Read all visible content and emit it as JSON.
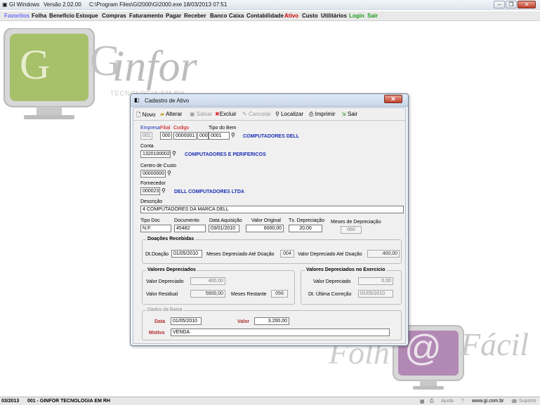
{
  "titlebar": {
    "app": "GI Windows",
    "version": "Versão  2.02.00",
    "path": "C:\\Program Files\\GI2000\\GI2000.exe",
    "datetime": "18/03/2013 07:51"
  },
  "menu": [
    "Favoritos",
    "Folha",
    "Benefício",
    "Estoque",
    "Compras",
    "Faturamento",
    "Pagar",
    "Receber",
    "Banco",
    "Caixa",
    "Contabilidade",
    "Ativo",
    "Custo",
    "Utilitários",
    "Login",
    "Sair"
  ],
  "logo": {
    "brand": "infor",
    "tagline": "TECNOLOGIA EM RH",
    "g": "G",
    "g2": "G",
    "promo1": "Folh",
    "promo2": "@",
    "promo3": "Fácil"
  },
  "window": {
    "title": "Cadastro de Ativo",
    "close": "✕",
    "toolbar": {
      "novo": "Novo",
      "alterar": "Alterar",
      "salvar": "Salvar",
      "excluir": "Excluir",
      "cancelar": "Cancelar",
      "localizar": "Localizar",
      "imprimir": "Imprimir",
      "sair": "Sair"
    },
    "labels": {
      "empresa": "Empresa",
      "filial": "Filial",
      "codigo": "Codigo",
      "tipo_bem": "Tipo do Bem",
      "conta": "Conta",
      "centro_custo": "Centro de Custo",
      "fornecedor": "Fornecedor",
      "descricao": "Descrição",
      "tipo_doc": "Tipo Doc",
      "documento": "Documento",
      "data_aquisicao": "Data Aquisição",
      "valor_original": "Valor Original",
      "tx_depreciacao": "Tx. Depreciação",
      "meses_depreciacao": "Meses de Depreciação"
    },
    "values": {
      "empresa": "001",
      "filial": "000",
      "codigo": "0000001",
      "codigo_suffix": "000",
      "tipo_bem": "0001",
      "tipo_bem_desc": "COMPUTADORES DELL",
      "conta": "1320100002",
      "conta_desc": "COMPUTADORES E PERIFERICOS",
      "centro_custo": "00000000",
      "fornecedor": "000023",
      "fornecedor_desc": "DELL COMPUTADORES LTDA",
      "descricao": "4 COMPUTADORES DA MARCA DELL",
      "tipo_doc": "N.F.",
      "documento": "45482",
      "data_aquisicao": "03/01/2010",
      "valor_original": "6000,00",
      "tx_depreciacao": "20,00",
      "meses_depreciacao": "060"
    },
    "doacoes": {
      "title": "Doações Recebidas",
      "dt_label": "Dt.Doação",
      "dt": "01/05/2010",
      "meses_label": "Meses Depreciado Até Doação",
      "meses": "004",
      "valor_label": "Valor Depreciado Até Doação",
      "valor": "400,00"
    },
    "depreciados": {
      "title": "Valores Depreciados",
      "valor_label": "Valor Depreciado",
      "valor": "400,00",
      "residual_label": "Valor Residual",
      "residual": "5600,00",
      "meses_label": "Meses Restante",
      "meses": "056"
    },
    "exercicio": {
      "title": "Valores Depreciados no Exercicio",
      "valor_label": "Valor Depreciado",
      "valor": "0,00",
      "dt_label": "Dt. Última Correção",
      "dt": "01/05/2010"
    },
    "baixa": {
      "title": "Dados da Baixa",
      "data_label": "Data",
      "data": "01/05/2010",
      "valor_label": "Valor",
      "valor": "3.200,00",
      "motivo_label": "Motivo",
      "motivo": "VENDA"
    }
  },
  "status": {
    "date": "03/2013",
    "company": "001 - GINFOR TECNOLOGIA EM RH",
    "ajuda": "Ajuda",
    "site": "www.gi.com.br",
    "suporte": "Suporte"
  }
}
